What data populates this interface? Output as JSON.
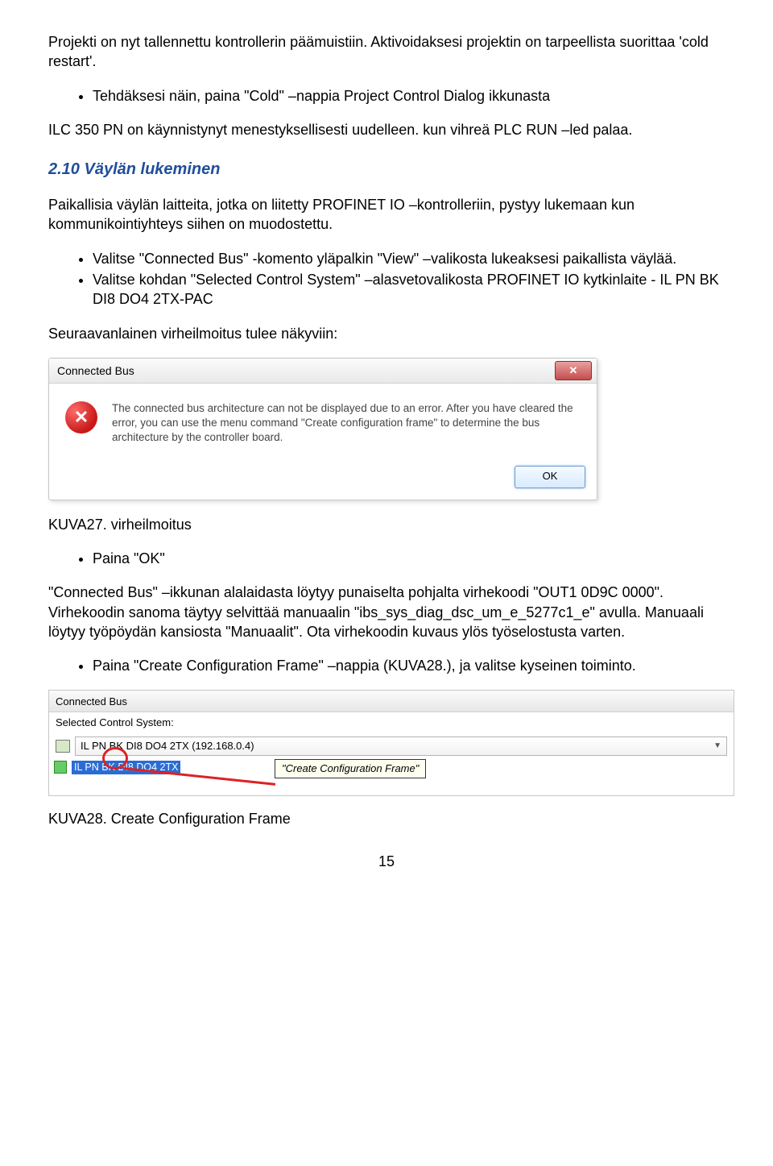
{
  "para1": "Projekti on nyt tallennettu kontrollerin päämuistiin. Aktivoidaksesi projektin on tarpeellista suorittaa 'cold restart'.",
  "bullet1": "Tehdäksesi näin, paina \"Cold\" –nappia Project Control Dialog ikkunasta",
  "para2": "ILC 350 PN on käynnistynyt menestyksellisesti uudelleen. kun vihreä PLC RUN –led palaa.",
  "heading": "2.10 Väylän lukeminen",
  "para3": "Paikallisia väylän laitteita, jotka on liitetty PROFINET IO –kontrolleriin, pystyy lukemaan kun kommunikointiyhteys siihen on muodostettu.",
  "bullet2": "Valitse \"Connected Bus\" -komento yläpalkin \"View\" –valikosta lukeaksesi paikallista väylää.",
  "bullet3": "Valitse kohdan \"Selected Control System\" –alasvetovalikosta PROFINET IO kytkinlaite - IL PN BK DI8 DO4 2TX-PAC",
  "para4": "Seuraavanlainen virheilmoitus tulee näkyviin:",
  "dialog": {
    "title": "Connected Bus",
    "msg": "The connected bus architecture can not be displayed due to an error. After you have cleared the error, you can use the menu command \"Create configuration frame\" to determine the bus architecture by the controller board.",
    "ok": "OK"
  },
  "caption1": "KUVA27. virheilmoitus",
  "bullet4": "Paina \"OK\"",
  "para5": "\"Connected Bus\" –ikkunan alalaidasta löytyy punaiselta pohjalta virhekoodi \"OUT1 0D9C 0000\". Virhekoodin sanoma täytyy selvittää manuaalin \"ibs_sys_diag_dsc_um_e_5277c1_e\" avulla. Manuaali löytyy työpöydän kansiosta \"Manuaalit\". Ota virhekoodin kuvaus ylös työselostusta varten.",
  "bullet5": "Paina \"Create Configuration Frame\" –nappia (KUVA28.), ja valitse kyseinen toiminto.",
  "panel2": {
    "title": "Connected Bus",
    "label": "Selected Control System:",
    "selected": "IL PN BK DI8 DO4 2TX (192.168.0.4)",
    "device": "IL PN BK DI8 DO4 2TX",
    "tooltip": "\"Create Configuration Frame\""
  },
  "caption2": "KUVA28. Create Configuration Frame",
  "pageNum": "15"
}
